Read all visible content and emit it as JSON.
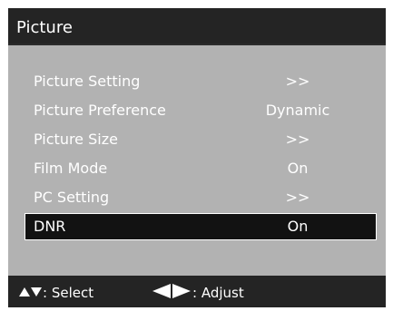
{
  "menu": {
    "title": "Picture",
    "items": [
      {
        "label": "Picture Setting",
        "value": ">>"
      },
      {
        "label": "Picture Preference",
        "value": "Dynamic"
      },
      {
        "label": "Picture Size",
        "value": ">>"
      },
      {
        "label": "Film Mode",
        "value": "On"
      },
      {
        "label": "PC Setting",
        "value": ">>"
      },
      {
        "label": "DNR",
        "value": "On",
        "selected": true
      }
    ]
  },
  "footer": {
    "select_icon": "up-down-arrows-icon",
    "select_label": ": Select",
    "adjust_icon": "left-right-arrows-icon",
    "adjust_label": ": Adjust"
  },
  "colors": {
    "panel_background": "#b2b2b2",
    "bar_background": "#242424",
    "selected_background": "#121212",
    "text": "#ffffff"
  }
}
